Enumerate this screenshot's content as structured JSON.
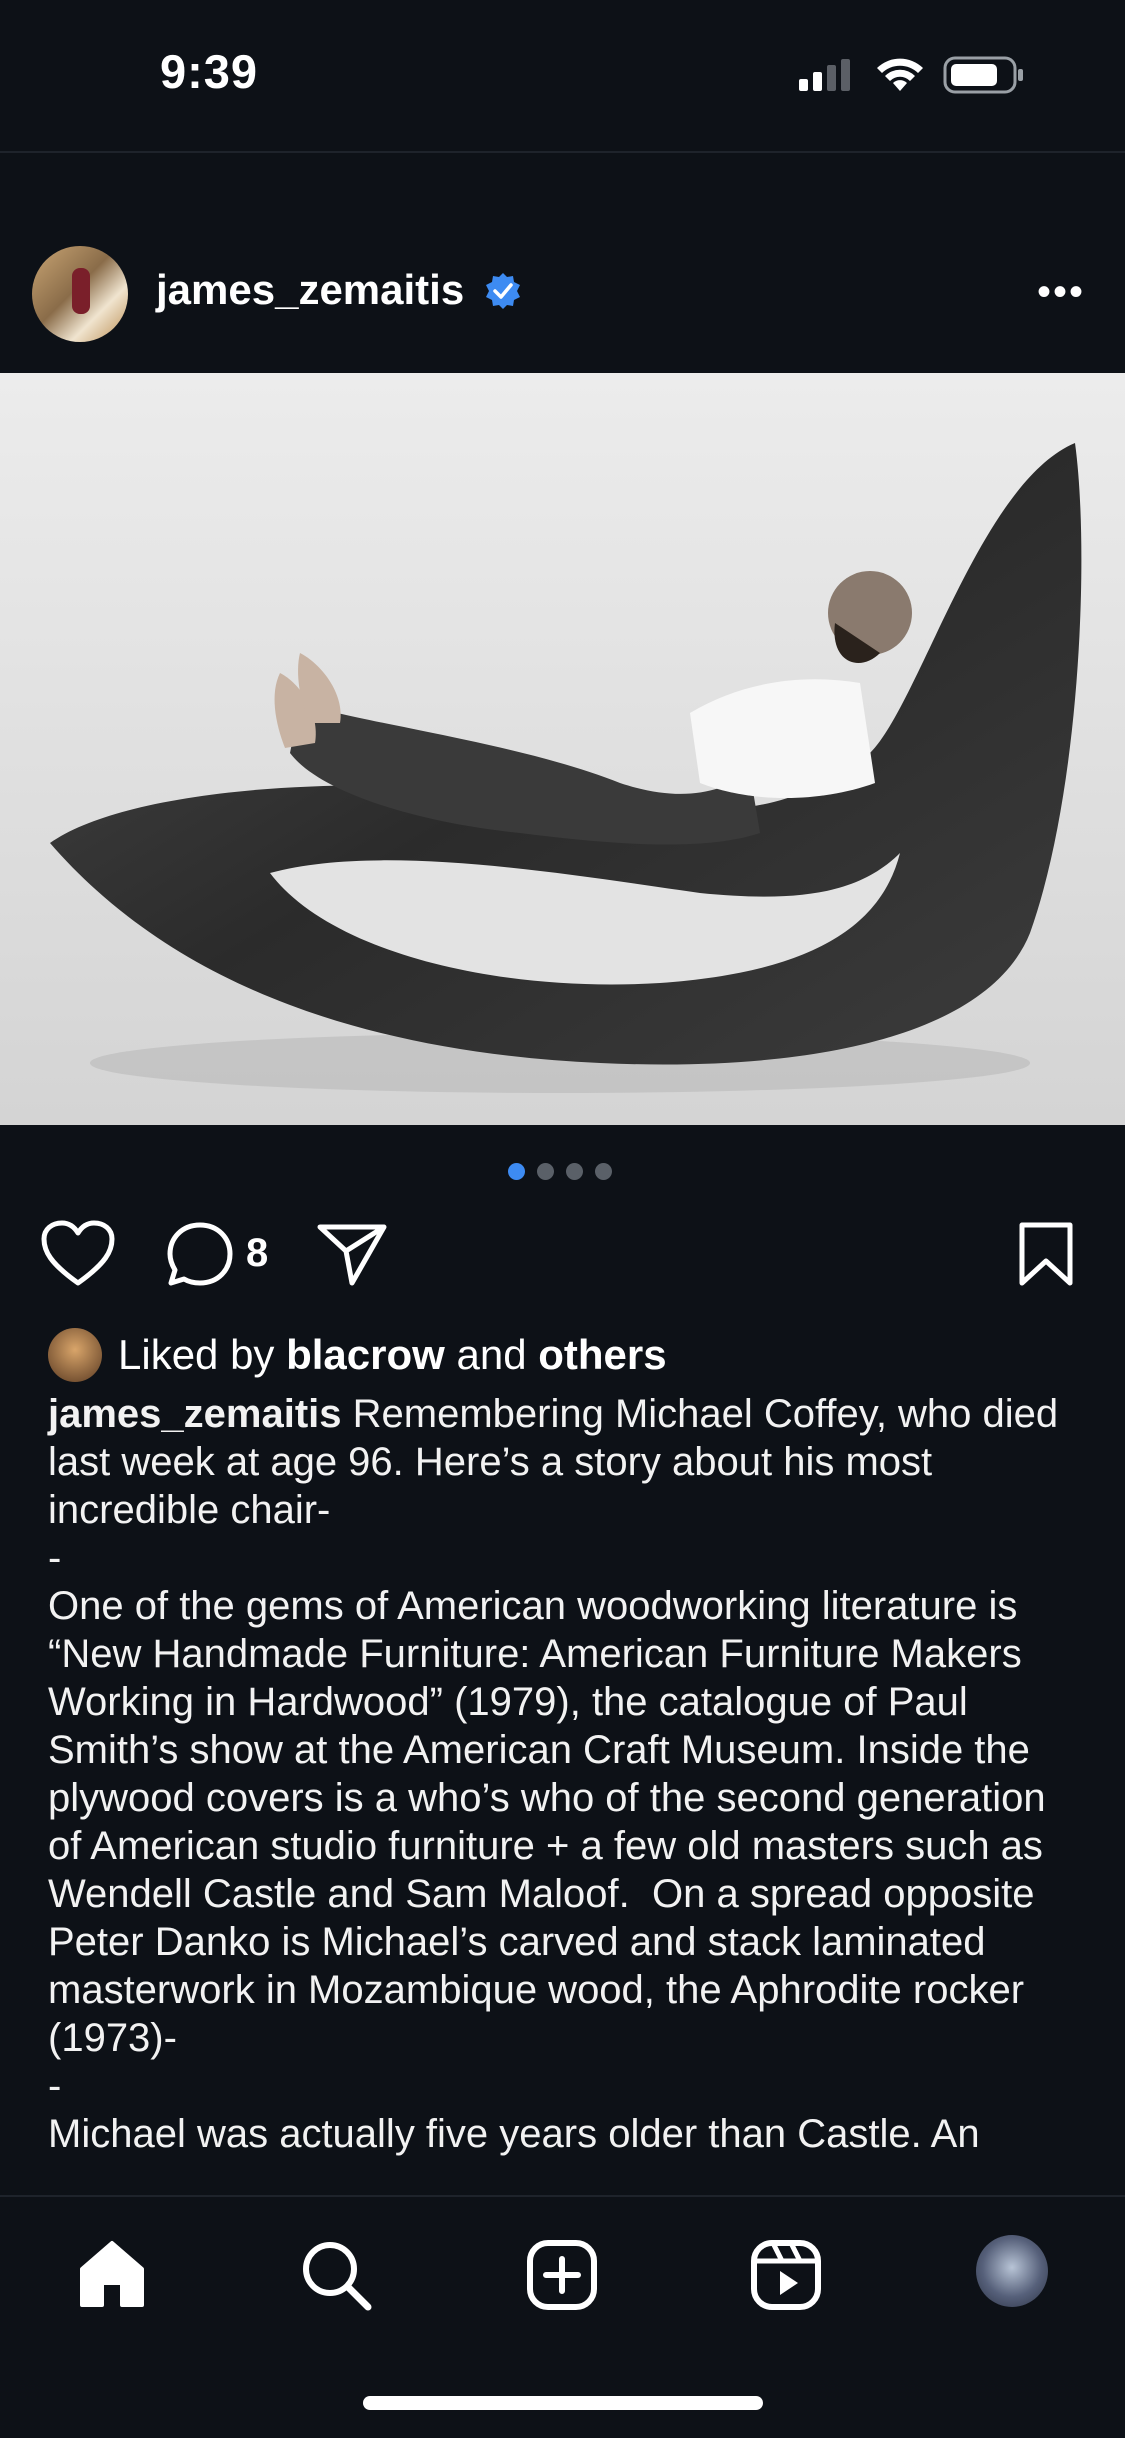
{
  "status_bar": {
    "time": "9:39"
  },
  "post": {
    "username": "james_zemaitis",
    "verified": true,
    "more_label": "•••",
    "carousel": {
      "count": 4,
      "active_index": 0
    },
    "comment_count": "8",
    "liked_by": {
      "prefix": "Liked by",
      "user": "blacrow",
      "middle": "and",
      "suffix": "others"
    },
    "caption": {
      "author": "james_zemaitis",
      "text": " Remembering Michael Coffey, who died last week at age 96. Here’s a story about his most incredible chair-\n-\nOne of the gems of American woodworking literature is “New Handmade Furniture: American Furniture Makers Working in Hardwood” (1979), the catalogue of Paul Smith’s show at the American Craft Museum. Inside the plywood covers is a who’s who of the second generation of American studio furniture + a few old masters such as Wendell Castle and Sam Maloof.  On a spread opposite Peter Danko is Michael’s carved and stack laminated masterwork in Mozambique wood, the Aphrodite rocker (1973)-\n-\nMichael was actually five years older than Castle. An"
    }
  },
  "tabbar": {
    "items": [
      "home-icon",
      "search-icon",
      "create-icon",
      "reels-icon",
      "profile-avatar"
    ]
  },
  "colors": {
    "background": "#0d1117",
    "accent": "#3d8bf2",
    "verified": "#3d8bf2"
  }
}
